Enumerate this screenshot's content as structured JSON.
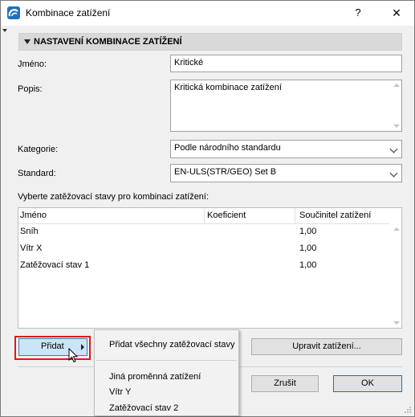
{
  "window": {
    "title": "Kombinace zatížení",
    "help_label": "?",
    "close_label": "✕"
  },
  "icons": [
    "app-logo-icon",
    "help-icon",
    "close-icon",
    "collapse-triangle-icon",
    "chevron-down-icon",
    "submenu-arrow-icon",
    "mouse-pointer-icon",
    "resize-grip-icon"
  ],
  "section": {
    "title": "NASTAVENÍ KOMBINACE ZATÍŽENÍ"
  },
  "form": {
    "name_label": "Jméno:",
    "name_value": "Kritické",
    "description_label": "Popis:",
    "description_value": "Kritická kombinace zatížení",
    "category_label": "Kategorie:",
    "category_value": "Podle národního standardu",
    "standard_label": "Standard:",
    "standard_value": "EN-ULS(STR/GEO) Set B"
  },
  "load_cases": {
    "prompt": "Vyberte zatěžovací stavy pro kombinaci zatížení:",
    "columns": [
      "Jméno",
      "Koeficient",
      "Součinitel zatížení"
    ],
    "rows": [
      {
        "name": "Sníh",
        "coefficient": "",
        "factor": "1,00"
      },
      {
        "name": "Vítr X",
        "coefficient": "",
        "factor": "1,00"
      },
      {
        "name": "Zatěžovací stav 1",
        "coefficient": "",
        "factor": "1,00"
      }
    ]
  },
  "buttons": {
    "add": "Přidat",
    "edit_loads": "Upravit zatížení...",
    "cancel": "Zrušit",
    "ok": "OK"
  },
  "add_menu": {
    "add_all": "Přidat všechny zatěžovací stavy",
    "items": [
      "Jiná proměnná zatížení",
      "Vítr Y",
      "Zatěžovací stav 2"
    ]
  },
  "colors": {
    "highlight_outline": "#e0161e",
    "button_hover": "#cce4f7",
    "accent": "#0078d7"
  }
}
